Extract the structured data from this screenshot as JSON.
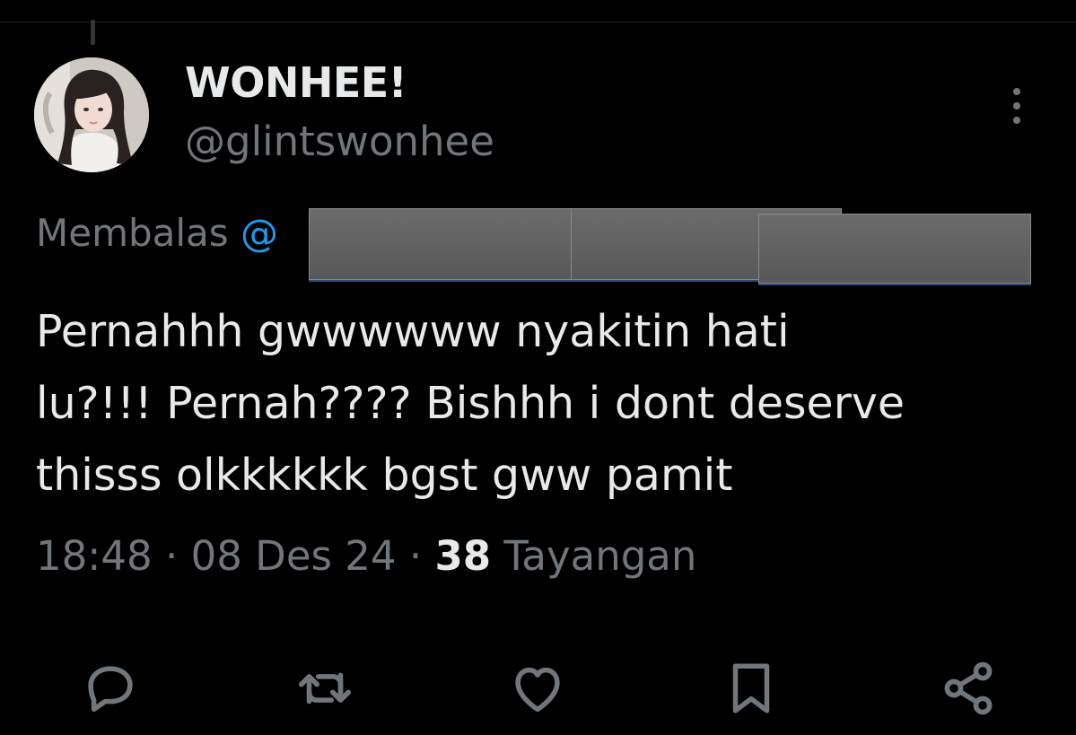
{
  "author": {
    "display_name": "WONHEE!",
    "handle": "@glintswonhee"
  },
  "reply": {
    "prefix": "Membalas",
    "mention": "@"
  },
  "tweet": {
    "text": "Pernahhh gwwwwww nyakitin hati\nlu?!!! Pernah???? Bishhh i dont deserve\nthisss olkkkkkk bgst gww pamit"
  },
  "meta": {
    "time": "18:48",
    "separator1": " · ",
    "date": "08 Des 24",
    "separator2": " · ",
    "views_count": "38",
    "views_label": " Tayangan"
  },
  "icons": {
    "more": "more-vertical-icon",
    "reply": "reply-icon",
    "retweet": "retweet-icon",
    "like": "heart-icon",
    "bookmark": "bookmark-icon",
    "share": "share-icon"
  },
  "colors": {
    "background": "#000000",
    "text_primary": "#e7e9ea",
    "text_secondary": "#71767b",
    "accent": "#1d9bf0"
  }
}
